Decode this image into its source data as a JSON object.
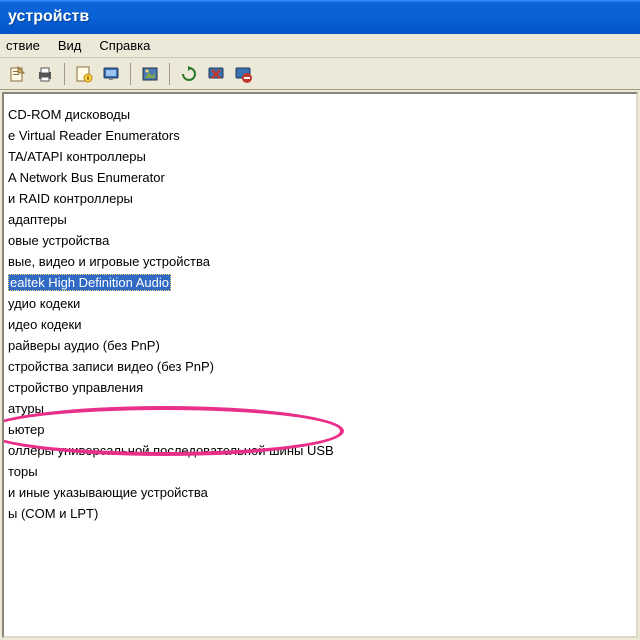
{
  "window": {
    "title": " устройств"
  },
  "menu": {
    "file": "ствие",
    "view": "Вид",
    "help": "Справка"
  },
  "toolbar_icons": [
    "action",
    "print",
    "properties",
    "monitor",
    "image",
    "refresh",
    "delete",
    "stop"
  ],
  "tree": {
    "items": [
      " CD-ROM дисководы",
      "e Virtual Reader Enumerators",
      "TA/ATAPI контроллеры",
      "A Network Bus Enumerator",
      "и RAID контроллеры",
      "адаптеры",
      "овые устройства",
      "вые, видео и игровые устройства",
      "ealtek High Definition Audio",
      "удио кодеки",
      "идео кодеки",
      "райверы аудио (без PnP)",
      "стройства записи видео (без PnP)",
      "стройство управления",
      "атуры",
      "ьютер",
      "оллеры универсальной последовательной шины USB",
      "торы",
      " и иные указывающие устройства",
      "ы (COM и LPT)"
    ],
    "selected_index": 8
  }
}
